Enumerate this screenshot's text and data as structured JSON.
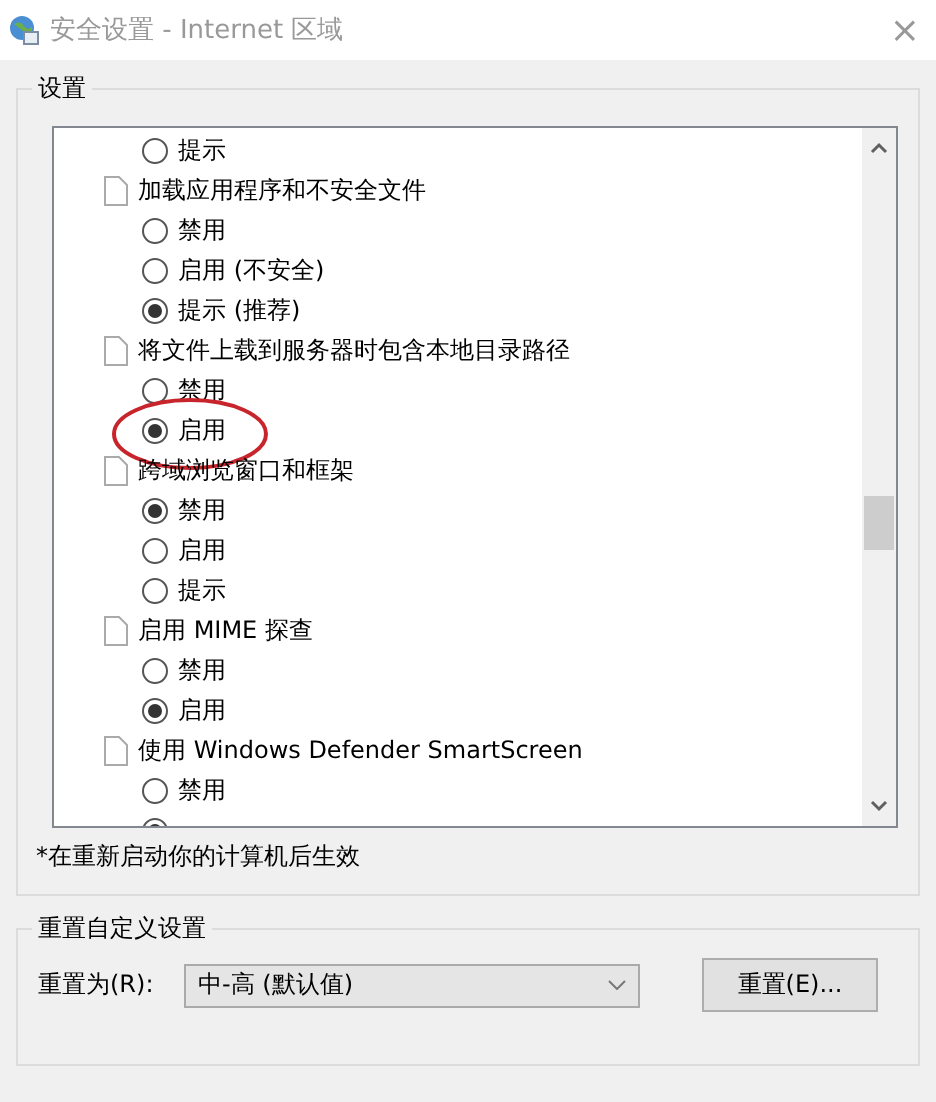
{
  "window": {
    "title": "安全设置 - Internet 区域",
    "close": "×"
  },
  "settings_group": {
    "title": "设置",
    "items": [
      {
        "kind": "option",
        "label": "提示",
        "selected": false
      },
      {
        "kind": "setting",
        "label": "加载应用程序和不安全文件",
        "children": [
          {
            "label": "禁用",
            "selected": false
          },
          {
            "label": "启用 (不安全)",
            "selected": false
          },
          {
            "label": "提示 (推荐)",
            "selected": true
          }
        ]
      },
      {
        "kind": "setting",
        "label": "将文件上载到服务器时包含本地目录路径",
        "children": [
          {
            "label": "禁用",
            "selected": false
          },
          {
            "label": "启用",
            "selected": true,
            "highlighted": true
          }
        ]
      },
      {
        "kind": "setting",
        "label": "跨域浏览窗口和框架",
        "children": [
          {
            "label": "禁用",
            "selected": true
          },
          {
            "label": "启用",
            "selected": false
          },
          {
            "label": "提示",
            "selected": false
          }
        ]
      },
      {
        "kind": "setting",
        "label": "启用 MIME 探查",
        "children": [
          {
            "label": "禁用",
            "selected": false
          },
          {
            "label": "启用",
            "selected": true
          }
        ]
      },
      {
        "kind": "setting",
        "label": "使用 Windows Defender SmartScreen",
        "children": [
          {
            "label": "禁用",
            "selected": false
          },
          {
            "selected": true
          }
        ]
      }
    ],
    "note": "*在重新启动你的计算机后生效"
  },
  "reset_group": {
    "title": "重置自定义设置",
    "label": "重置为(R):",
    "select_value": "中-高 (默认值)",
    "button": "重置(E)..."
  }
}
